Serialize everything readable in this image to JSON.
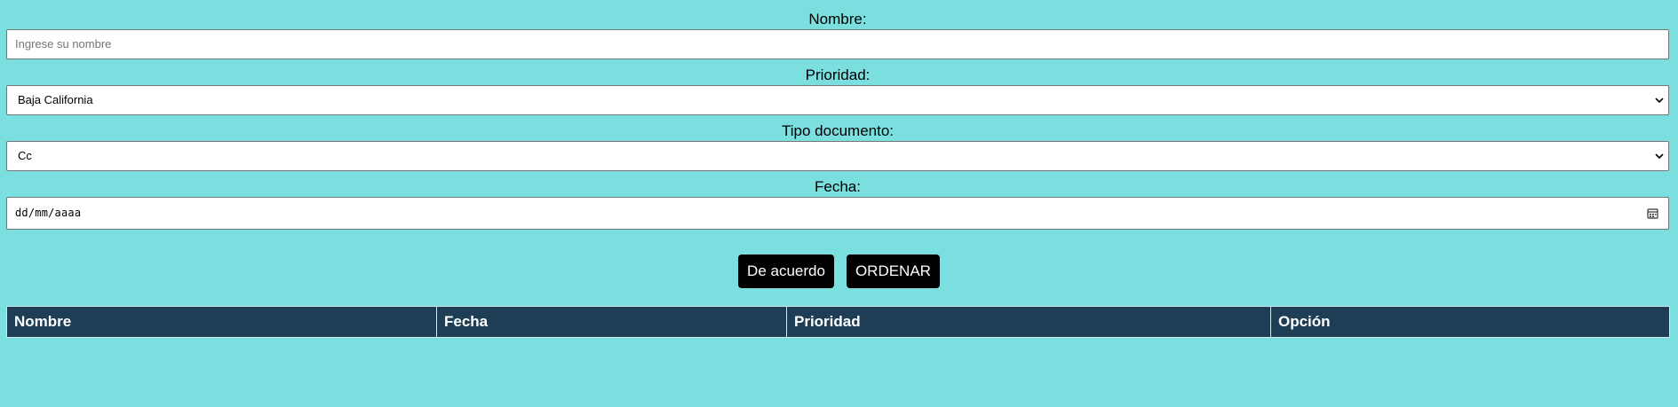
{
  "form": {
    "nombre": {
      "label": "Nombre:",
      "placeholder": "Ingrese su nombre",
      "value": ""
    },
    "prioridad": {
      "label": "Prioridad:",
      "selected": "Baja California"
    },
    "tipo_documento": {
      "label": "Tipo documento:",
      "selected": "Cc"
    },
    "fecha": {
      "label": "Fecha:",
      "placeholder": "dd/mm/aaaa"
    }
  },
  "buttons": {
    "accept_label": "De acuerdo",
    "sort_label": "ORDENAR"
  },
  "table": {
    "columns": [
      "Nombre",
      "Fecha",
      "Prioridad",
      "Opción"
    ],
    "rows": []
  },
  "colors": {
    "background": "#7bdfe0",
    "table_header": "#1e3e55",
    "button": "#000000"
  },
  "icons": {
    "select_arrow": "chevron-down-icon",
    "date_picker": "calendar-icon"
  }
}
